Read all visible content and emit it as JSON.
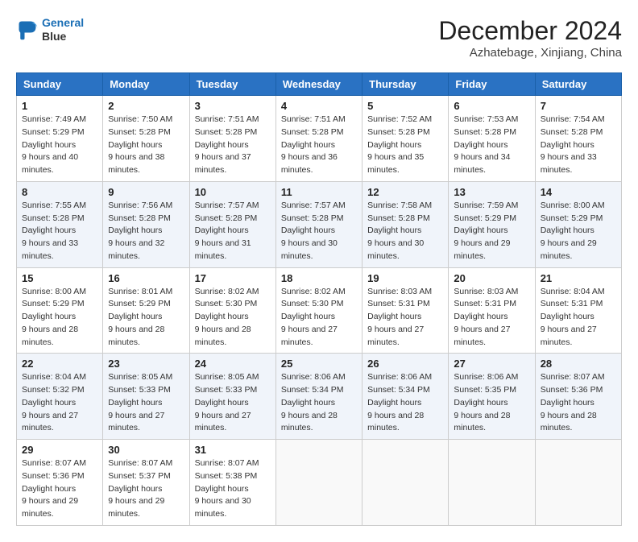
{
  "header": {
    "logo_line1": "General",
    "logo_line2": "Blue",
    "month_title": "December 2024",
    "location": "Azhatebage, Xinjiang, China"
  },
  "weekdays": [
    "Sunday",
    "Monday",
    "Tuesday",
    "Wednesday",
    "Thursday",
    "Friday",
    "Saturday"
  ],
  "weeks": [
    [
      {
        "day": "1",
        "sunrise": "7:49 AM",
        "sunset": "5:29 PM",
        "daylight": "9 hours and 40 minutes."
      },
      {
        "day": "2",
        "sunrise": "7:50 AM",
        "sunset": "5:28 PM",
        "daylight": "9 hours and 38 minutes."
      },
      {
        "day": "3",
        "sunrise": "7:51 AM",
        "sunset": "5:28 PM",
        "daylight": "9 hours and 37 minutes."
      },
      {
        "day": "4",
        "sunrise": "7:51 AM",
        "sunset": "5:28 PM",
        "daylight": "9 hours and 36 minutes."
      },
      {
        "day": "5",
        "sunrise": "7:52 AM",
        "sunset": "5:28 PM",
        "daylight": "9 hours and 35 minutes."
      },
      {
        "day": "6",
        "sunrise": "7:53 AM",
        "sunset": "5:28 PM",
        "daylight": "9 hours and 34 minutes."
      },
      {
        "day": "7",
        "sunrise": "7:54 AM",
        "sunset": "5:28 PM",
        "daylight": "9 hours and 33 minutes."
      }
    ],
    [
      {
        "day": "8",
        "sunrise": "7:55 AM",
        "sunset": "5:28 PM",
        "daylight": "9 hours and 33 minutes."
      },
      {
        "day": "9",
        "sunrise": "7:56 AM",
        "sunset": "5:28 PM",
        "daylight": "9 hours and 32 minutes."
      },
      {
        "day": "10",
        "sunrise": "7:57 AM",
        "sunset": "5:28 PM",
        "daylight": "9 hours and 31 minutes."
      },
      {
        "day": "11",
        "sunrise": "7:57 AM",
        "sunset": "5:28 PM",
        "daylight": "9 hours and 30 minutes."
      },
      {
        "day": "12",
        "sunrise": "7:58 AM",
        "sunset": "5:28 PM",
        "daylight": "9 hours and 30 minutes."
      },
      {
        "day": "13",
        "sunrise": "7:59 AM",
        "sunset": "5:29 PM",
        "daylight": "9 hours and 29 minutes."
      },
      {
        "day": "14",
        "sunrise": "8:00 AM",
        "sunset": "5:29 PM",
        "daylight": "9 hours and 29 minutes."
      }
    ],
    [
      {
        "day": "15",
        "sunrise": "8:00 AM",
        "sunset": "5:29 PM",
        "daylight": "9 hours and 28 minutes."
      },
      {
        "day": "16",
        "sunrise": "8:01 AM",
        "sunset": "5:29 PM",
        "daylight": "9 hours and 28 minutes."
      },
      {
        "day": "17",
        "sunrise": "8:02 AM",
        "sunset": "5:30 PM",
        "daylight": "9 hours and 28 minutes."
      },
      {
        "day": "18",
        "sunrise": "8:02 AM",
        "sunset": "5:30 PM",
        "daylight": "9 hours and 27 minutes."
      },
      {
        "day": "19",
        "sunrise": "8:03 AM",
        "sunset": "5:31 PM",
        "daylight": "9 hours and 27 minutes."
      },
      {
        "day": "20",
        "sunrise": "8:03 AM",
        "sunset": "5:31 PM",
        "daylight": "9 hours and 27 minutes."
      },
      {
        "day": "21",
        "sunrise": "8:04 AM",
        "sunset": "5:31 PM",
        "daylight": "9 hours and 27 minutes."
      }
    ],
    [
      {
        "day": "22",
        "sunrise": "8:04 AM",
        "sunset": "5:32 PM",
        "daylight": "9 hours and 27 minutes."
      },
      {
        "day": "23",
        "sunrise": "8:05 AM",
        "sunset": "5:33 PM",
        "daylight": "9 hours and 27 minutes."
      },
      {
        "day": "24",
        "sunrise": "8:05 AM",
        "sunset": "5:33 PM",
        "daylight": "9 hours and 27 minutes."
      },
      {
        "day": "25",
        "sunrise": "8:06 AM",
        "sunset": "5:34 PM",
        "daylight": "9 hours and 28 minutes."
      },
      {
        "day": "26",
        "sunrise": "8:06 AM",
        "sunset": "5:34 PM",
        "daylight": "9 hours and 28 minutes."
      },
      {
        "day": "27",
        "sunrise": "8:06 AM",
        "sunset": "5:35 PM",
        "daylight": "9 hours and 28 minutes."
      },
      {
        "day": "28",
        "sunrise": "8:07 AM",
        "sunset": "5:36 PM",
        "daylight": "9 hours and 28 minutes."
      }
    ],
    [
      {
        "day": "29",
        "sunrise": "8:07 AM",
        "sunset": "5:36 PM",
        "daylight": "9 hours and 29 minutes."
      },
      {
        "day": "30",
        "sunrise": "8:07 AM",
        "sunset": "5:37 PM",
        "daylight": "9 hours and 29 minutes."
      },
      {
        "day": "31",
        "sunrise": "8:07 AM",
        "sunset": "5:38 PM",
        "daylight": "9 hours and 30 minutes."
      },
      null,
      null,
      null,
      null
    ]
  ]
}
